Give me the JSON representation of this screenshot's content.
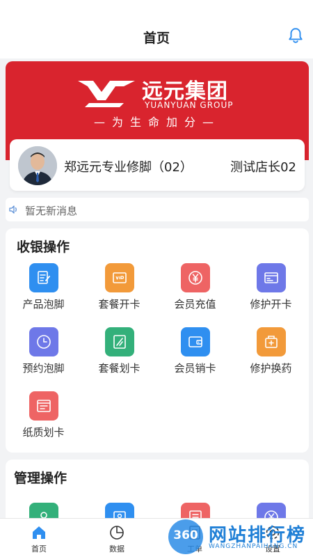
{
  "header": {
    "title": "首页",
    "icon": "bell-icon"
  },
  "banner": {
    "brand_name": "远元集团",
    "brand_en": "YUANYUAN GROUP",
    "slogan": "—为生命加分—",
    "color": "#d9242e"
  },
  "profile": {
    "store_name": "郑远元专业修脚（02）",
    "manager": "测试店长02"
  },
  "notice": {
    "text": "暂无新消息",
    "icon": "speaker-icon"
  },
  "cashier": {
    "title": "收银操作",
    "items": [
      {
        "label": "产品泡脚",
        "icon": "document-edit-icon",
        "color": "#2f8ff0"
      },
      {
        "label": "套餐开卡",
        "icon": "vip-card-icon",
        "color": "#f29a3a"
      },
      {
        "label": "会员充值",
        "icon": "yuan-icon",
        "color": "#ee6464"
      },
      {
        "label": "修护开卡",
        "icon": "id-card-icon",
        "color": "#6e78e8"
      },
      {
        "label": "预约泡脚",
        "icon": "clock-icon",
        "color": "#6e78e8"
      },
      {
        "label": "套餐划卡",
        "icon": "card-swipe-icon",
        "color": "#33b07a"
      },
      {
        "label": "会员销卡",
        "icon": "wallet-icon",
        "color": "#2f8ff0"
      },
      {
        "label": "修护换药",
        "icon": "medicine-box-icon",
        "color": "#f29a3a"
      },
      {
        "label": "纸质划卡",
        "icon": "paper-card-icon",
        "color": "#ee6464"
      }
    ]
  },
  "management": {
    "title": "管理操作",
    "items": [
      {
        "icon": "staff-icon",
        "color": "#33b07a"
      },
      {
        "icon": "contact-card-icon",
        "color": "#2f8ff0"
      },
      {
        "icon": "report-icon",
        "color": "#ee6464"
      },
      {
        "icon": "yuan-settings-icon",
        "color": "#6e78e8"
      }
    ]
  },
  "tabbar": {
    "tabs": [
      {
        "label": "首页",
        "icon": "home-icon",
        "active": true
      },
      {
        "label": "数据",
        "icon": "pie-chart-icon",
        "active": false
      },
      {
        "label": "工单",
        "icon": "worksheet-icon",
        "active": false
      },
      {
        "label": "设置",
        "icon": "settings-icon",
        "active": false
      }
    ]
  },
  "watermark": {
    "number": "360",
    "text": "网站排行榜",
    "url": "WANGZHANPAIHANG.CN"
  }
}
